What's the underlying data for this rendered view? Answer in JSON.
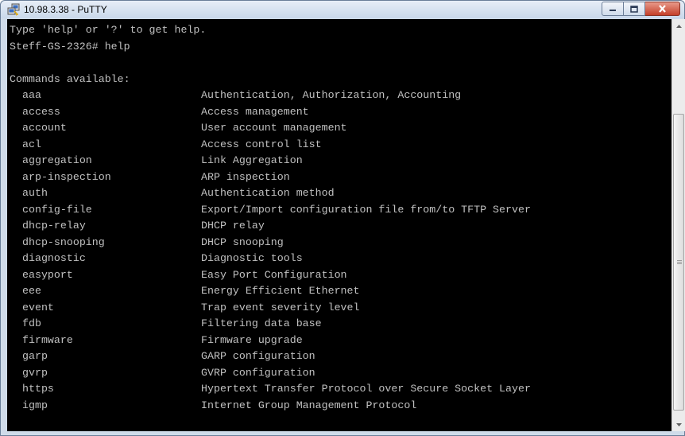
{
  "window": {
    "title": "10.98.3.38 - PuTTY",
    "icons": {
      "app": "putty-icon",
      "minimize": "minimize-icon",
      "maximize": "maximize-icon",
      "close": "close-icon"
    }
  },
  "terminal": {
    "header_lines": [
      "Type 'help' or '?' to get help.",
      "Steff-GS-2326# help",
      "",
      "Commands available:"
    ],
    "commands": [
      {
        "name": "aaa",
        "desc": "Authentication, Authorization, Accounting"
      },
      {
        "name": "access",
        "desc": "Access management"
      },
      {
        "name": "account",
        "desc": "User account management"
      },
      {
        "name": "acl",
        "desc": "Access control list"
      },
      {
        "name": "aggregation",
        "desc": "Link Aggregation"
      },
      {
        "name": "arp-inspection",
        "desc": "ARP inspection"
      },
      {
        "name": "auth",
        "desc": "Authentication method"
      },
      {
        "name": "config-file",
        "desc": "Export/Import configuration file from/to TFTP Server"
      },
      {
        "name": "dhcp-relay",
        "desc": "DHCP relay"
      },
      {
        "name": "dhcp-snooping",
        "desc": "DHCP snooping"
      },
      {
        "name": "diagnostic",
        "desc": "Diagnostic tools"
      },
      {
        "name": "easyport",
        "desc": "Easy Port Configuration"
      },
      {
        "name": "eee",
        "desc": "Energy Efficient Ethernet"
      },
      {
        "name": "event",
        "desc": "Trap event severity level"
      },
      {
        "name": "fdb",
        "desc": "Filtering data base"
      },
      {
        "name": "firmware",
        "desc": "Firmware upgrade"
      },
      {
        "name": "garp",
        "desc": "GARP configuration"
      },
      {
        "name": "gvrp",
        "desc": "GVRP configuration"
      },
      {
        "name": "https",
        "desc": "Hypertext Transfer Protocol over Secure Socket Layer"
      },
      {
        "name": "igmp",
        "desc": "Internet Group Management Protocol"
      }
    ],
    "colors": {
      "background": "#000000",
      "foreground": "#c0c0c0"
    }
  },
  "scrollbar": {
    "up_icon": "scroll-up-arrow-icon",
    "down_icon": "scroll-down-arrow-icon",
    "grip_icon": "scroll-grip-icon",
    "position_fraction": 0.92,
    "visible_fraction": 0.77
  }
}
